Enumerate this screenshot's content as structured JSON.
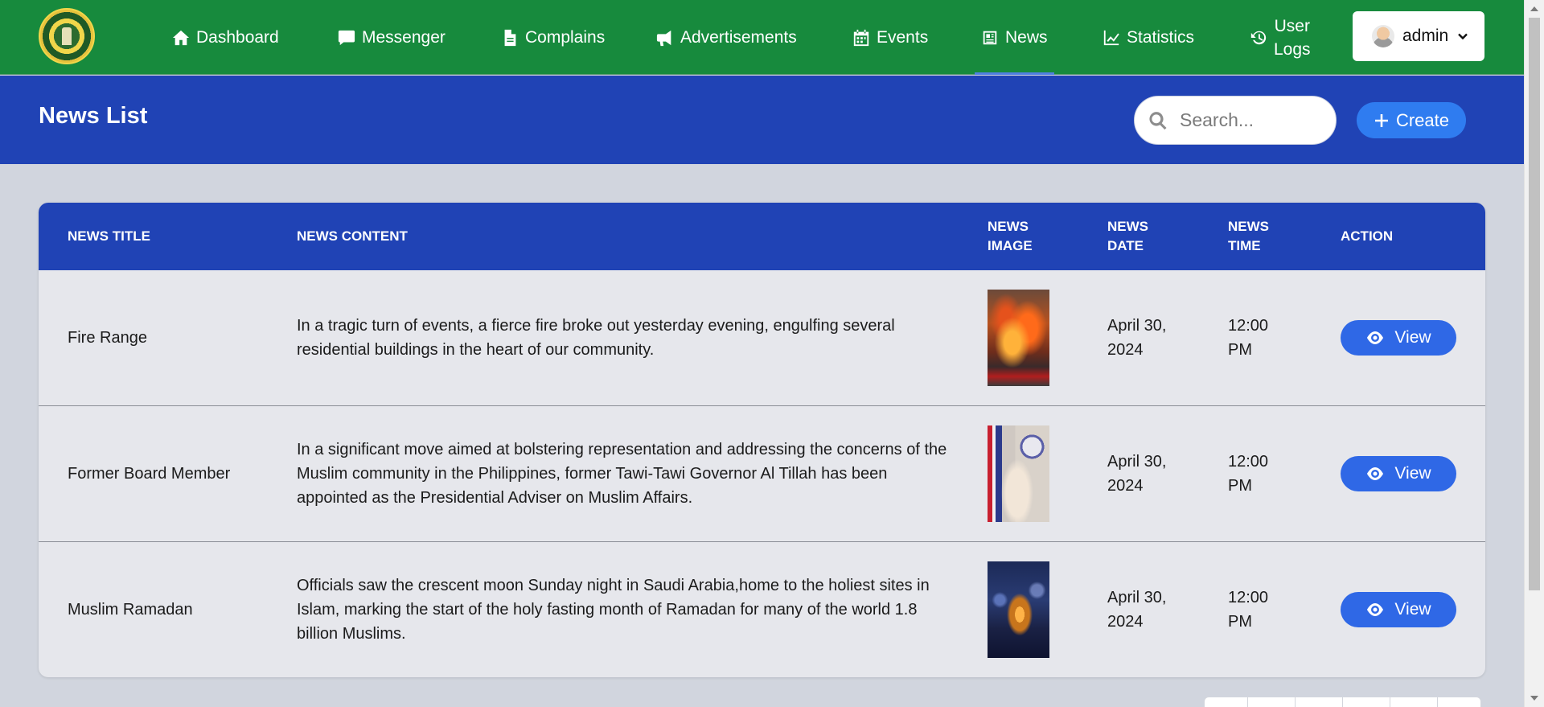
{
  "nav": {
    "items": [
      {
        "label": "Dashboard",
        "icon": "home-icon"
      },
      {
        "label": "Messenger",
        "icon": "message-icon"
      },
      {
        "label": "Complains",
        "icon": "document-icon"
      },
      {
        "label": "Advertisements",
        "icon": "megaphone-icon"
      },
      {
        "label": "Events",
        "icon": "calendar-icon"
      },
      {
        "label": "News",
        "icon": "newspaper-icon",
        "active": true
      },
      {
        "label": "Statistics",
        "icon": "line-chart-icon"
      }
    ],
    "user_logs": {
      "line1": "User",
      "line2": "Logs",
      "icon": "history-icon"
    },
    "account": {
      "label": "admin",
      "icon": "chevron-down-icon"
    }
  },
  "header": {
    "title": "News List",
    "search_placeholder": "Search...",
    "create_label": "Create"
  },
  "table": {
    "headers": {
      "title": "NEWS TITLE",
      "content": "NEWS CONTENT",
      "image_l1": "NEWS",
      "image_l2": "IMAGE",
      "date_l1": "NEWS",
      "date_l2": "DATE",
      "time_l1": "NEWS",
      "time_l2": "TIME",
      "action": "ACTION"
    },
    "rows": [
      {
        "title": "Fire Range",
        "content": "In a tragic turn of events, a fierce fire broke out yesterday evening, engulfing several residential buildings in the heart of our community.",
        "date_l1": "April 30,",
        "date_l2": "2024",
        "time_l1": "12:00",
        "time_l2": "PM",
        "action": "View"
      },
      {
        "title": "Former Board Member",
        "content": "In a significant move aimed at bolstering representation and addressing the concerns of the Muslim community in the Philippines, former Tawi-Tawi Governor Al Tillah has been appointed as the Presidential Adviser on Muslim Affairs.",
        "date_l1": "April 30,",
        "date_l2": "2024",
        "time_l1": "12:00",
        "time_l2": "PM",
        "action": "View"
      },
      {
        "title": "Muslim Ramadan",
        "content": "Officials saw the crescent moon Sunday night in Saudi Arabia,home to the holiest sites in Islam, marking the start of the holy fasting month of Ramadan for many of the world 1.8 billion Muslims.",
        "date_l1": "April 30,",
        "date_l2": "2024",
        "time_l1": "12:00",
        "time_l2": "PM",
        "action": "View"
      }
    ]
  },
  "colors": {
    "nav_green": "#178a3d",
    "header_blue": "#2043b5",
    "button_blue": "#2f68e6",
    "page_bg": "#d1d5de"
  }
}
